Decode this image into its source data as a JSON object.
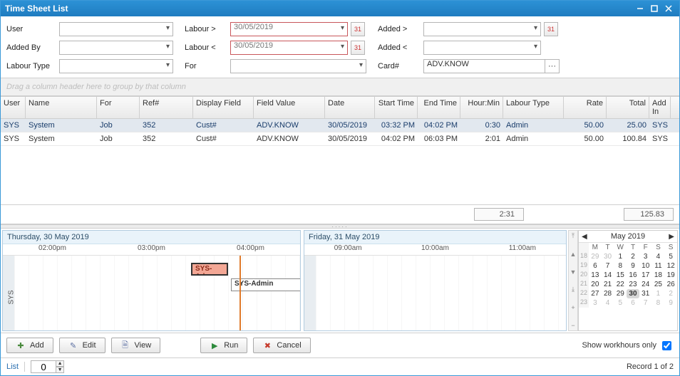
{
  "title": "Time Sheet List",
  "filters": {
    "user_label": "User",
    "user_value": "",
    "addedby_label": "Added By",
    "addedby_value": "",
    "labourtype_label": "Labour Type",
    "labourtype_value": "",
    "labour_gt_label": "Labour >",
    "labour_gt_value": "30/05/2019",
    "labour_lt_label": "Labour <",
    "labour_lt_value": "30/05/2019",
    "for_label": "For",
    "for_value": "",
    "added_gt_label": "Added >",
    "added_gt_value": "",
    "added_lt_label": "Added <",
    "added_lt_value": "",
    "card_label": "Card#",
    "card_value": "ADV.KNOW"
  },
  "group_hint": "Drag a column header here to group by that column",
  "columns": {
    "user": "User",
    "name": "Name",
    "for": "For",
    "ref": "Ref#",
    "disp": "Display Field",
    "fv": "Field Value",
    "date": "Date",
    "st": "Start Time",
    "et": "End Time",
    "hm": "Hour:Min",
    "lt": "Labour Type",
    "rate": "Rate",
    "total": "Total",
    "ai": "Add In"
  },
  "rows": [
    {
      "user": "SYS",
      "name": "System",
      "for": "Job",
      "ref": "352",
      "disp": "Cust#",
      "fv": "ADV.KNOW",
      "date": "30/05/2019",
      "st": "03:32 PM",
      "et": "04:02 PM",
      "hm": "0:30",
      "lt": "Admin",
      "rate": "50.00",
      "total": "25.00",
      "ai": "SYS"
    },
    {
      "user": "SYS",
      "name": "System",
      "for": "Job",
      "ref": "352",
      "disp": "Cust#",
      "fv": "ADV.KNOW",
      "date": "30/05/2019",
      "st": "04:02 PM",
      "et": "06:03 PM",
      "hm": "2:01",
      "lt": "Admin",
      "rate": "50.00",
      "total": "100.84",
      "ai": "SYS"
    }
  ],
  "totals": {
    "hours": "2:31",
    "amount": "125.83"
  },
  "timeline": {
    "day1": {
      "title": "Thursday, 30 May 2019",
      "ticks": [
        "02:00pm",
        "03:00pm",
        "04:00pm"
      ],
      "blk1": "SYS-Ad...",
      "blk2": "SYS-Admin"
    },
    "day2": {
      "title": "Friday, 31 May 2019",
      "ticks": [
        "09:00am",
        "10:00am",
        "11:00am"
      ]
    },
    "ylabel": "SYS"
  },
  "calendar": {
    "title": "May 2019",
    "weekdays": [
      "M",
      "T",
      "W",
      "T",
      "F",
      "S",
      "S"
    ],
    "weeks": [
      {
        "wk": "18",
        "days": [
          {
            "n": "29",
            "o": 1
          },
          {
            "n": "30",
            "o": 1
          },
          {
            "n": "1"
          },
          {
            "n": "2"
          },
          {
            "n": "3"
          },
          {
            "n": "4"
          },
          {
            "n": "5"
          }
        ]
      },
      {
        "wk": "19",
        "days": [
          {
            "n": "6"
          },
          {
            "n": "7"
          },
          {
            "n": "8"
          },
          {
            "n": "9"
          },
          {
            "n": "10"
          },
          {
            "n": "11"
          },
          {
            "n": "12"
          }
        ]
      },
      {
        "wk": "20",
        "days": [
          {
            "n": "13"
          },
          {
            "n": "14"
          },
          {
            "n": "15"
          },
          {
            "n": "16"
          },
          {
            "n": "17"
          },
          {
            "n": "18"
          },
          {
            "n": "19"
          }
        ]
      },
      {
        "wk": "21",
        "days": [
          {
            "n": "20"
          },
          {
            "n": "21"
          },
          {
            "n": "22"
          },
          {
            "n": "23"
          },
          {
            "n": "24"
          },
          {
            "n": "25"
          },
          {
            "n": "26"
          }
        ]
      },
      {
        "wk": "22",
        "days": [
          {
            "n": "27"
          },
          {
            "n": "28"
          },
          {
            "n": "29"
          },
          {
            "n": "30",
            "t": 1
          },
          {
            "n": "31"
          },
          {
            "n": "1",
            "o": 1
          },
          {
            "n": "2",
            "o": 1
          }
        ]
      },
      {
        "wk": "23",
        "days": [
          {
            "n": "3",
            "o": 1
          },
          {
            "n": "4",
            "o": 1
          },
          {
            "n": "5",
            "o": 1
          },
          {
            "n": "6",
            "o": 1
          },
          {
            "n": "7",
            "o": 1
          },
          {
            "n": "8",
            "o": 1
          },
          {
            "n": "9",
            "o": 1
          }
        ]
      }
    ]
  },
  "buttons": {
    "add": "Add",
    "edit": "Edit",
    "view": "View",
    "run": "Run",
    "cancel": "Cancel"
  },
  "workhours_label": "Show workhours only",
  "status": {
    "list": "List",
    "count": "0",
    "record": "Record 1 of 2"
  }
}
